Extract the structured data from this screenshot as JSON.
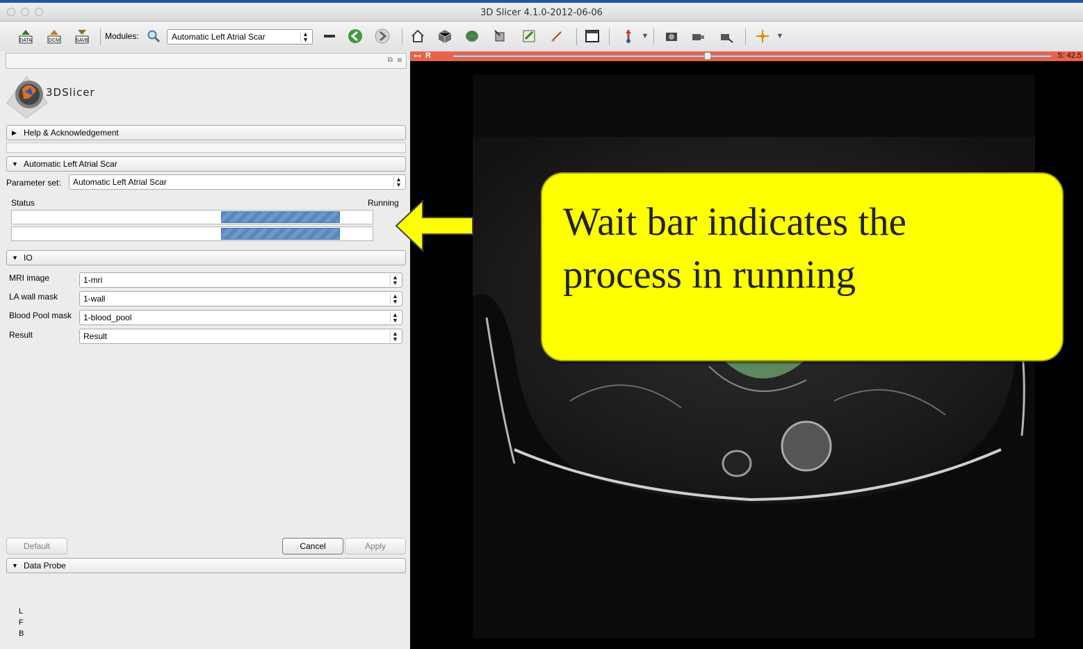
{
  "window": {
    "title": "3D Slicer 4.1.0-2012-06-06"
  },
  "toolbar": {
    "data_label": "DATA",
    "dcm_label": "DCM",
    "save_label": "SAVE",
    "modules_label": "Modules:",
    "module_selected": "Automatic Left Atrial Scar"
  },
  "panel": {
    "logo_text": "3DSlicer",
    "help_section": "Help & Acknowledgement",
    "module_section": "Automatic Left Atrial Scar",
    "parameter_set_label": "Parameter set:",
    "parameter_set_value": "Automatic Left Atrial Scar",
    "status_label": "Status",
    "status_value": "Running",
    "progress_bars": [
      {
        "busy_start": 0.58,
        "busy_end": 0.91
      },
      {
        "busy_start": 0.58,
        "busy_end": 0.91
      }
    ],
    "io_section": "IO",
    "io_fields": [
      {
        "label": "MRI image",
        "value": "1-mri"
      },
      {
        "label": "LA wall mask",
        "value": "1-wall"
      },
      {
        "label": "Blood Pool mask",
        "value": "1-blood_pool"
      },
      {
        "label": "Result",
        "value": "Result"
      }
    ],
    "buttons": {
      "default": "Default",
      "cancel": "Cancel",
      "apply": "Apply"
    },
    "data_probe_section": "Data Probe",
    "probe_letters": [
      "L",
      "F",
      "B"
    ]
  },
  "view": {
    "slice_label": "R",
    "slice_offset": "S: 42.5",
    "slider_fraction": 0.42
  },
  "callout": {
    "line1": "Wait bar indicates the",
    "line2": "process in running"
  },
  "colors": {
    "slice_bar": "#e8634a",
    "callout": "#ffff00",
    "progress": "#5a87c0",
    "segmentation": "#6a9a6a"
  }
}
